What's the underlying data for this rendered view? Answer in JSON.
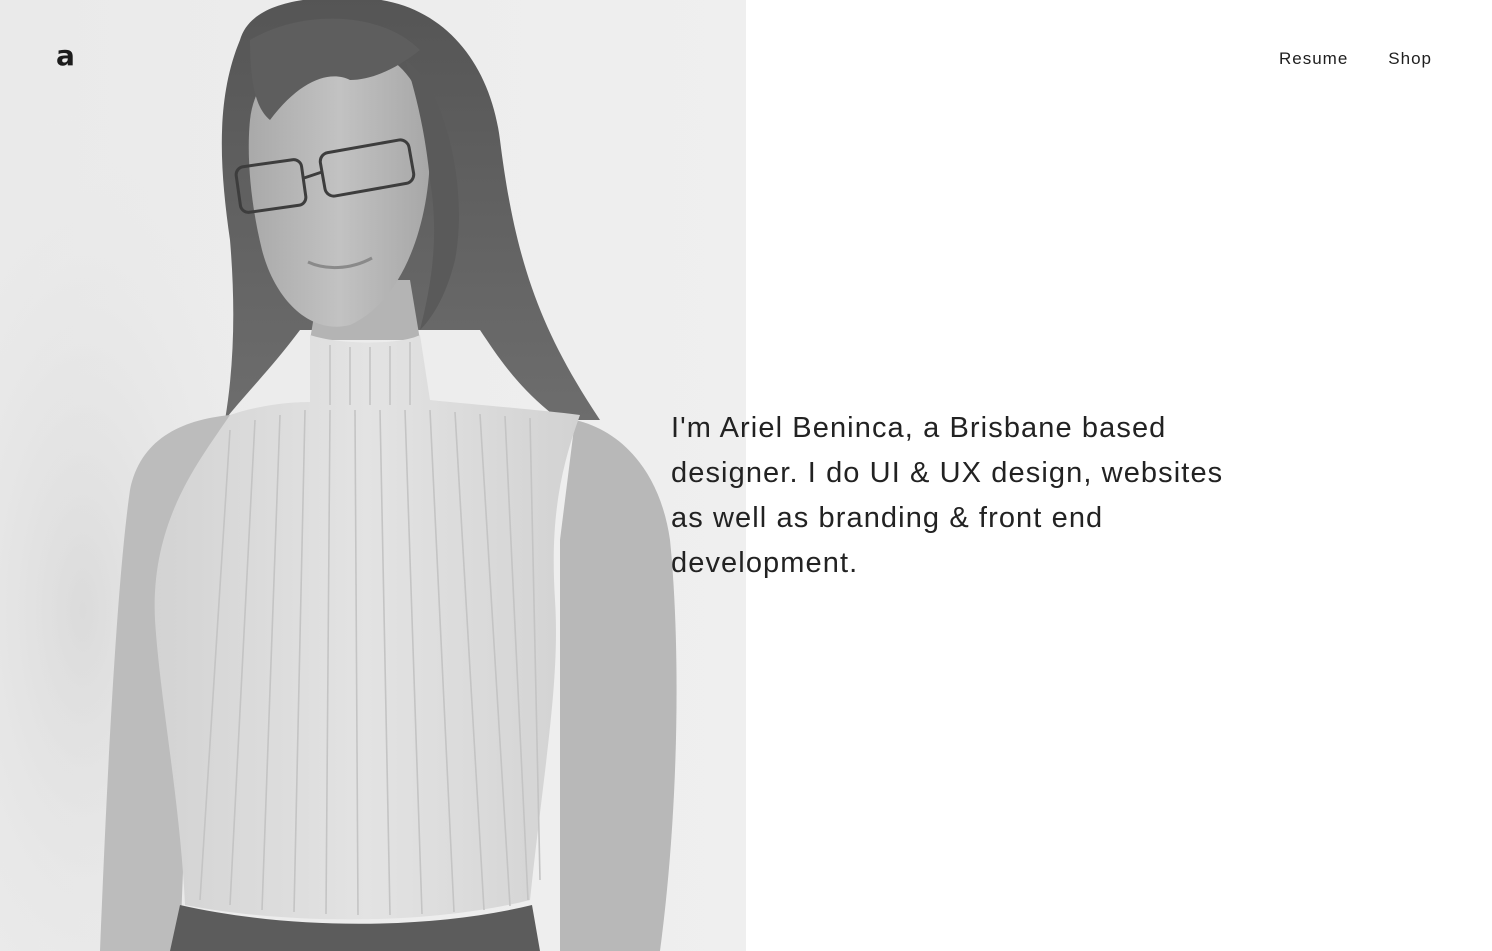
{
  "header": {
    "logo": "a",
    "nav": [
      {
        "label": "Resume"
      },
      {
        "label": "Shop"
      }
    ]
  },
  "hero": {
    "intro": "I'm Ariel Beninca, a Brisbane based designer. I do UI & UX design, websites as well as branding & front end development."
  },
  "colors": {
    "photo_background": "#ececec",
    "page_background": "#ffffff",
    "text": "#222222"
  }
}
